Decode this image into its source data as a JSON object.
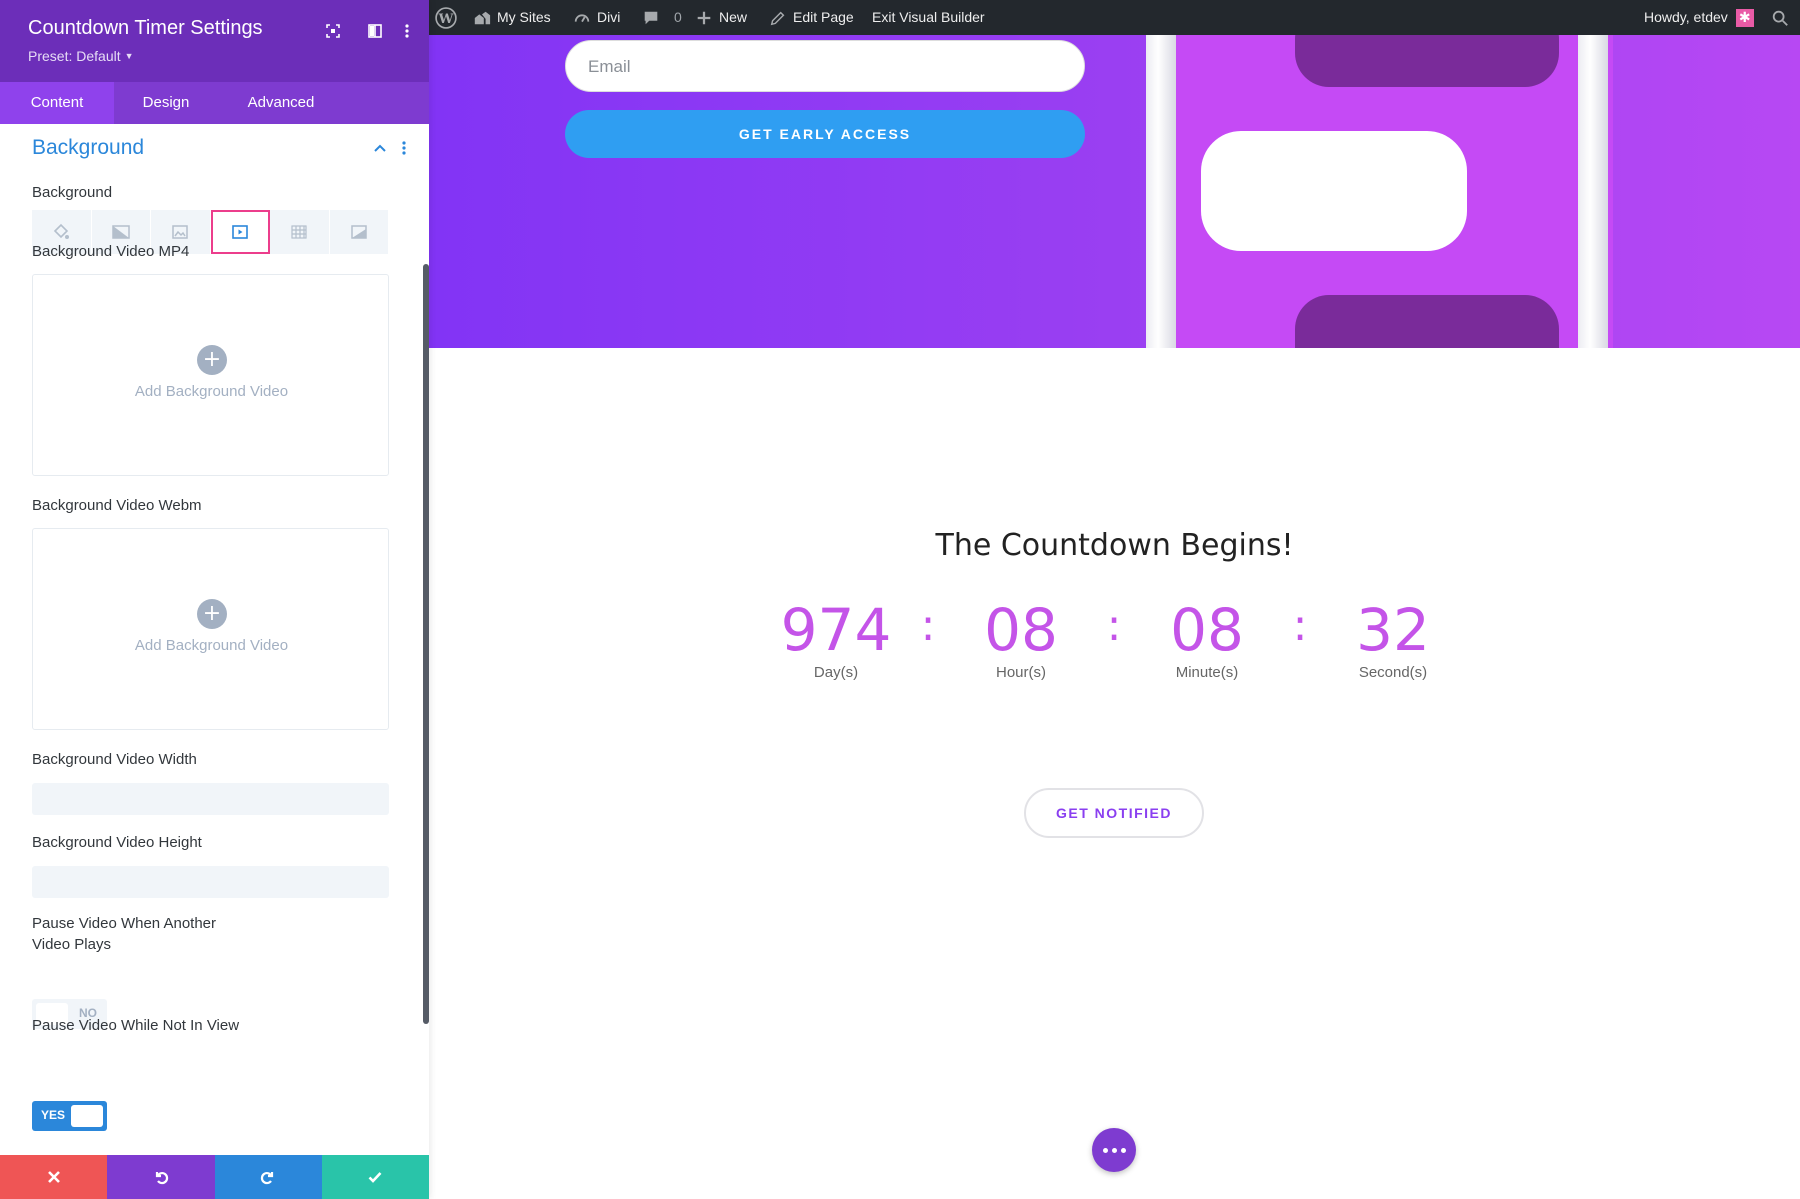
{
  "panel": {
    "title": "Countdown Timer Settings",
    "preset": "Preset: Default",
    "tabs": [
      "Content",
      "Design",
      "Advanced"
    ],
    "active_tab": "Content",
    "section_title": "Background",
    "fields": {
      "background_label": "Background",
      "background_types": [
        "color",
        "gradient",
        "image",
        "video",
        "pattern",
        "mask"
      ],
      "active_background_type": "video",
      "video_mp4_label": "Background Video MP4",
      "video_mp4_add": "Add Background Video",
      "video_webm_label": "Background Video Webm",
      "video_webm_add": "Add Background Video",
      "video_width_label": "Background Video Width",
      "video_width_value": "",
      "video_height_label": "Background Video Height",
      "video_height_value": "",
      "pause_other_label": "Pause Video When Another Video Plays",
      "pause_other_value": "NO",
      "pause_view_label": "Pause Video While Not In View",
      "pause_view_value": "YES"
    },
    "footer_buttons": [
      "discard",
      "undo",
      "redo",
      "save"
    ]
  },
  "adminbar": {
    "items": {
      "my_sites": "My Sites",
      "divi": "Divi",
      "comments_count": "0",
      "new": "New",
      "edit_page": "Edit Page",
      "exit_builder": "Exit Visual Builder"
    },
    "howdy": "Howdy, etdev"
  },
  "page": {
    "email_placeholder": "Email",
    "early_access": "GET EARLY ACCESS",
    "countdown_title": "The Countdown Begins!",
    "countdown": {
      "days": "974",
      "days_label": "Day(s)",
      "hours": "08",
      "hours_label": "Hour(s)",
      "minutes": "08",
      "minutes_label": "Minute(s)",
      "seconds": "32",
      "seconds_label": "Second(s)",
      "separator": ":"
    },
    "notify_button": "GET NOTIFIED"
  },
  "colors": {
    "panel_header": "#6c2eb9",
    "accent_blue": "#2b87da",
    "countdown_purple": "#c454e8",
    "highlight_pink": "#ec3d8c"
  }
}
